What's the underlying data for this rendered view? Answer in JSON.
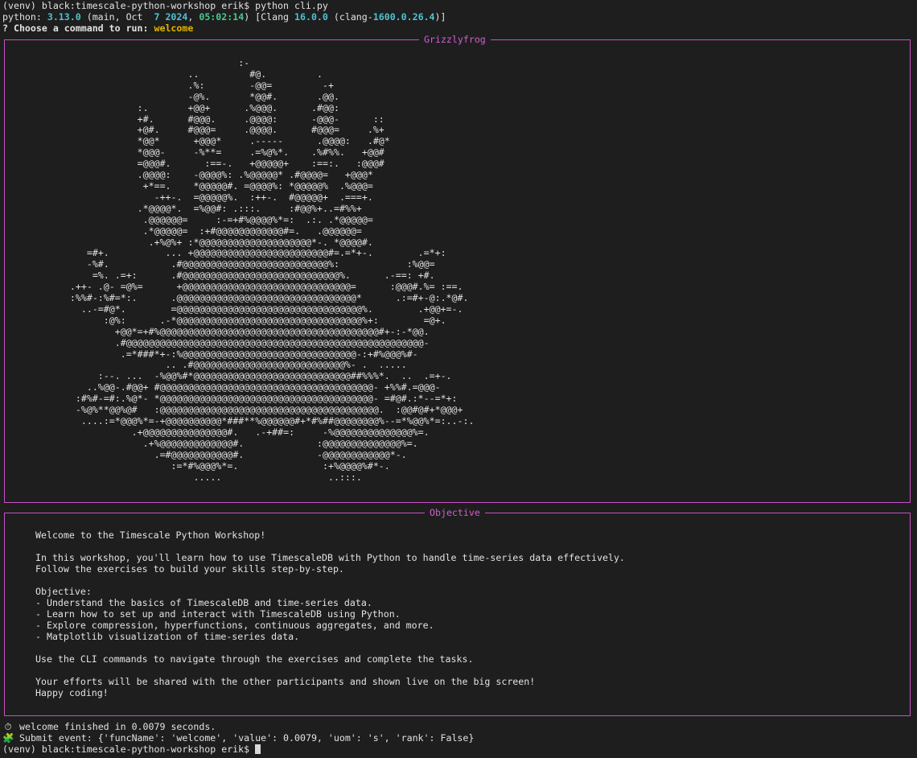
{
  "terminal": {
    "command_line": {
      "prompt": "(venv) black:timescale-python-workshop erik$ ",
      "command": "python cli.py"
    },
    "python_info": {
      "label": "python: ",
      "version": "3.13.0",
      "open_paren": " (main, Oct  ",
      "day": "7",
      "space": " ",
      "year": "2024",
      "comma": ", ",
      "time": "05:02:14",
      "clang_prefix": ") [Clang ",
      "clang_version": "16.0.0",
      "clang_mid": " (clang-",
      "clang_build": "1600.0.26.4",
      "clang_suffix": ")]"
    },
    "question": {
      "mark": "? ",
      "text": "Choose a command to run: ",
      "answer": "welcome"
    },
    "art_panel": {
      "title": "Grizzlyfrog",
      "ascii_art": "                                   :-\n                          ..         #@.         .\n                          .%:        -@@=         -+\n                          -@%.       *@@#.       .@@.\n                 :.       +@@+      .%@@@.      .#@@:\n                 +#.      #@@@.     .@@@@:      -@@@-      ::\n                 +@#.     #@@@=     .@@@@.      #@@@=     .%+\n                 *@@*      +@@@*     .-----      .@@@@:   .#@*\n                 *@@@-     -%**=     .=%@%*.    .%#%%.   +@@#\n                 =@@@#.      :==-.   +@@@@@+    :==:.   :@@@#\n                 .@@@@:    -@@@@%: .%@@@@@* .#@@@@=   +@@@*\n                  +*==.    *@@@@@#. =@@@@%: *@@@@@%  .%@@@=\n                    -++-.  =@@@@@%.  :++-.  #@@@@@+  .===+.\n                 .*@@@@*.  =%@@#: .:::.     :#@@%+..=#%%+\n                  .@@@@@@=     :-=+#%@@@@%*=:  .:. .*@@@@@=\n                  .*@@@@@=  :+#@@@@@@@@@@@@#=.   .@@@@@@=\n                   .+%@%+ :*@@@@@@@@@@@@@@@@@@@@*-. *@@@@#.\n        =#+.          ... +@@@@@@@@@@@@@@@@@@@@@@@@#=.=*+-.        .=*+:\n        -%#.           .#@@@@@@@@@@@@@@@@@@@@@@@@@@%:            :%@@=\n         =%. .=+:      .#@@@@@@@@@@@@@@@@@@@@@@@@@@@@%.      .-==: +#.\n     .++- .@- =@%=      +@@@@@@@@@@@@@@@@@@@@@@@@@@@@@@=      :@@@#.%= :==.\n     :%%#-:%#=*:.      .@@@@@@@@@@@@@@@@@@@@@@@@@@@@@@@@*      .:=#+-@:.*@#.\n       ..-=#@*.        =@@@@@@@@@@@@@@@@@@@@@@@@@@@@@@@@@%.        .+@@+=-.\n           :@%:      .-*@@@@@@@@@@@@@@@@@@@@@@@@@@@@@@@@@%+:        =@+.\n             +@@*=+#%@@@@@@@@@@@@@@@@@@@@@@@@@@@@@@@@@@@@@@@#+-:-*@@.\n             .#@@@@@@@@@@@@@@@@@@@@@@@@@@@@@@@@@@@@@@@@@@@@@@@@@@@@@-\n              .=*###*+-:%@@@@@@@@@@@@@@@@@@@@@@@@@@@@@@@-:+#%@@@%#-\n                      .. .#@@@@@@@@@@@@@@@@@@@@@@@@@@@%- .  .....\n          :--. ...  -%@@%#*@@@@@@@@@@@@@@@@@@@@@@@@@@@@##%%%*.  ..  .=+-.\n        ..%@@-.#@@+ #@@@@@@@@@@@@@@@@@@@@@@@@@@@@@@@@@@@@@@- +%%#.=@@@-\n      :#%#-=#:.%@*- *@@@@@@@@@@@@@@@@@@@@@@@@@@@@@@@@@@@@@@- =#@#.:*--=*+:\n      -%@%**@@%@#   :@@@@@@@@@@@@@@@@@@@@@@@@@@@@@@@@@@@@@@@.  :@@#@#+*@@@+\n       ....:=*@@@%*=-+@@@@@@@@@@*###**%@@@@@@#+*#%##@@@@@@@@%--=*%@@%*=:..-:.\n                .+@@@@@@@@@@@@@@@#.   .-+##=:     -%@@@@@@@@@@@@@@%=.\n                  .+%@@@@@@@@@@@@@#.             :@@@@@@@@@@@@@@%=.\n                    .=#@@@@@@@@@@@#.             -@@@@@@@@@@@@*-.\n                       :=*#%@@@%*=.               :+%@@@@%#*-.\n                           .....                   ..:::."
    },
    "objective_panel": {
      "title": "Objective",
      "lines": [
        "Welcome to the Timescale Python Workshop!",
        "",
        "In this workshop, you'll learn how to use TimescaleDB with Python to handle time-series data effectively.",
        "Follow the exercises to build your skills step-by-step.",
        "",
        "Objective:",
        "- Understand the basics of TimescaleDB and time-series data.",
        "- Learn how to set up and interact with TimescaleDB using Python.",
        "- Explore compression, hyperfunctions, continuous aggregates, and more.",
        "- Matplotlib visualization of time-series data.",
        "",
        "Use the CLI commands to navigate through the exercises and complete the tasks.",
        "",
        "Your efforts will be shared with the other participants and shown live on the big screen!",
        "Happy coding!"
      ]
    },
    "status_lines": {
      "timer_icon": "stopwatch-icon",
      "timer_glyph": "⏱",
      "timer_text": " welcome finished in 0.0079 seconds.",
      "submit_icon": "puzzle-piece-icon",
      "submit_glyph": "🧩",
      "submit_text": " Submit event: {'funcName': 'welcome', 'value': 0.0079, 'uom': 's', 'rank': False}"
    },
    "final_prompt": "(venv) black:timescale-python-workshop erik$ ",
    "colors": {
      "background": "#1e1e1e",
      "text": "#e2e2e2",
      "panel_border": "#c84fc4",
      "panel_title": "#d25fd0",
      "number_cyan": "#4fc1d1",
      "number_green": "#47c98a",
      "answer_yellow": "#e0b400"
    }
  }
}
